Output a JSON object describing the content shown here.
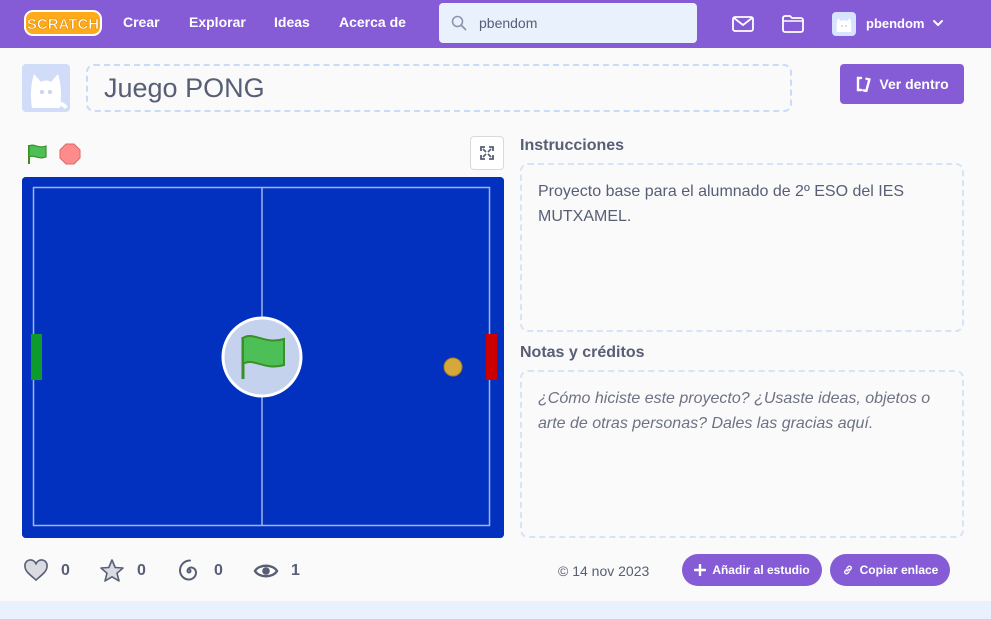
{
  "nav": {
    "links": [
      "Crear",
      "Explorar",
      "Ideas",
      "Acerca de"
    ],
    "search_value": "pbendom",
    "username": "pbendom",
    "logo_text": "SCRATCH"
  },
  "project": {
    "title": "Juego PONG",
    "see_inside_label": "Ver dentro"
  },
  "instructions": {
    "heading": "Instrucciones",
    "text": "Proyecto base para el alumnado de 2º ESO del IES MUTXAMEL."
  },
  "notes": {
    "heading": "Notas y créditos",
    "placeholder": "¿Cómo hiciste este proyecto? ¿Usaste ideas, objetos o arte de otras personas? Dales las gracias aquí."
  },
  "stats": {
    "loves": "0",
    "favorites": "0",
    "remixes": "0",
    "views": "1"
  },
  "share_date": "© 14 nov 2023",
  "actions": {
    "add_to_studio": "Añadir al estudio",
    "copy_link": "Copiar enlace"
  },
  "colors": {
    "brand": "#855cd6",
    "stage_bg": "#0231c0",
    "left_paddle": "#0f9b2c",
    "right_paddle": "#cc0000",
    "ball": "#d4a83a"
  },
  "icons": [
    "scratch-logo",
    "search-icon",
    "messages-icon",
    "my-stuff-icon",
    "chevron-down-icon",
    "remix-icon",
    "green-flag-icon",
    "stop-icon",
    "fullscreen-icon",
    "heart-icon",
    "star-icon",
    "remix-spiral-icon",
    "eye-icon",
    "plus-icon",
    "link-icon"
  ]
}
